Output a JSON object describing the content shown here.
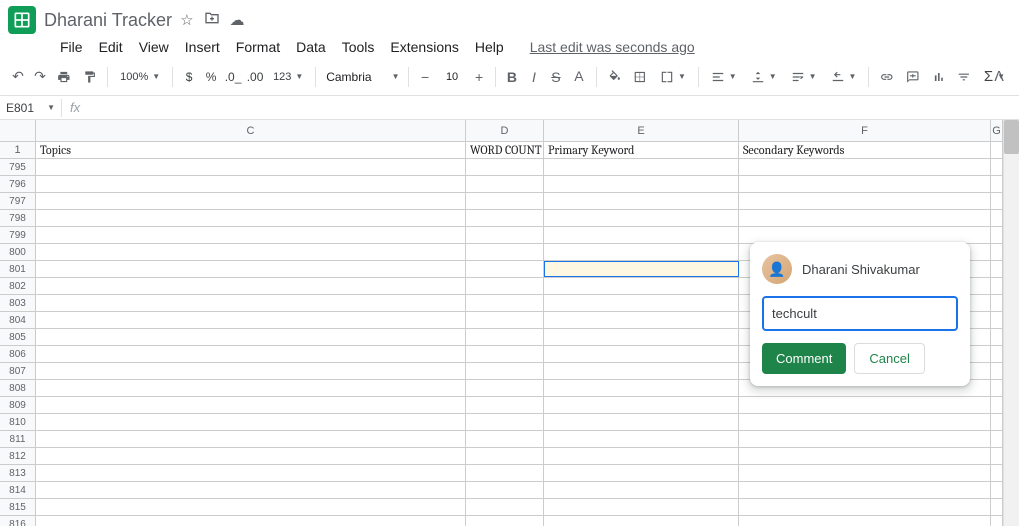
{
  "doc": {
    "title": "Dharani Tracker"
  },
  "menu": {
    "file": "File",
    "edit": "Edit",
    "view": "View",
    "insert": "Insert",
    "format": "Format",
    "data": "Data",
    "tools": "Tools",
    "extensions": "Extensions",
    "help": "Help",
    "last_edit": "Last edit was seconds ago"
  },
  "toolbar": {
    "zoom": "100%",
    "format_num": "123",
    "font": "Cambria",
    "size": "10"
  },
  "namebox": {
    "ref": "E801"
  },
  "columns": {
    "C": "C",
    "D": "D",
    "E": "E",
    "F": "F",
    "G": "G"
  },
  "header_row": {
    "num": "1",
    "C": "Topics",
    "D": "WORD COUNT",
    "E": "Primary Keyword",
    "F": "Secondary Keywords"
  },
  "rows": [
    "795",
    "796",
    "797",
    "798",
    "799",
    "800",
    "801",
    "802",
    "803",
    "804",
    "805",
    "806",
    "807",
    "808",
    "809",
    "810",
    "811",
    "812",
    "813",
    "814",
    "815",
    "816"
  ],
  "comment": {
    "user": "Dharani Shivakumar",
    "text": "techcult",
    "submit": "Comment",
    "cancel": "Cancel"
  }
}
